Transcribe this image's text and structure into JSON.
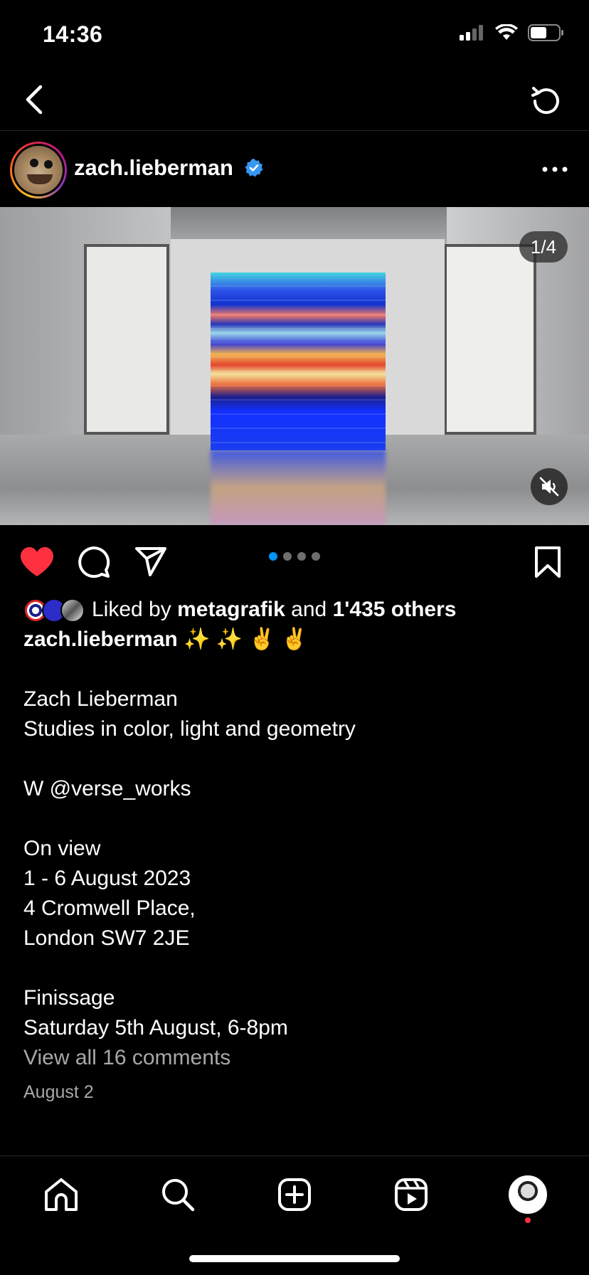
{
  "status_bar": {
    "time": "14:36"
  },
  "post": {
    "username": "zach.lieberman",
    "media_counter": "1/4",
    "carousel": {
      "total": 4,
      "active": 1
    }
  },
  "likes": {
    "prefix": "Liked by",
    "liker": "metagrafik",
    "conjunction": "and",
    "others": "1'435 others"
  },
  "caption": {
    "author": "zach.lieberman",
    "emoji": "✨ ✨ ✌️ ✌️",
    "lines": [
      "Zach Lieberman",
      "Studies in color, light and geometry",
      "",
      "W @verse_works",
      "",
      "On view",
      "1 - 6 August 2023",
      "4 Cromwell Place,",
      "London SW7 2JE",
      "",
      "Finissage",
      "Saturday 5th August, 6-8pm"
    ]
  },
  "comments_link": "View all 16 comments",
  "post_date": "August 2",
  "colors": {
    "like_red": "#ff3040",
    "accent_blue": "#0095f6",
    "muted": "#a8a8a8"
  },
  "icons": [
    "back-icon",
    "refresh-icon",
    "verified-icon",
    "more-icon",
    "mute-icon",
    "heart-icon",
    "comment-icon",
    "share-icon",
    "bookmark-icon",
    "home-icon",
    "search-icon",
    "create-icon",
    "reels-icon",
    "profile-icon"
  ]
}
